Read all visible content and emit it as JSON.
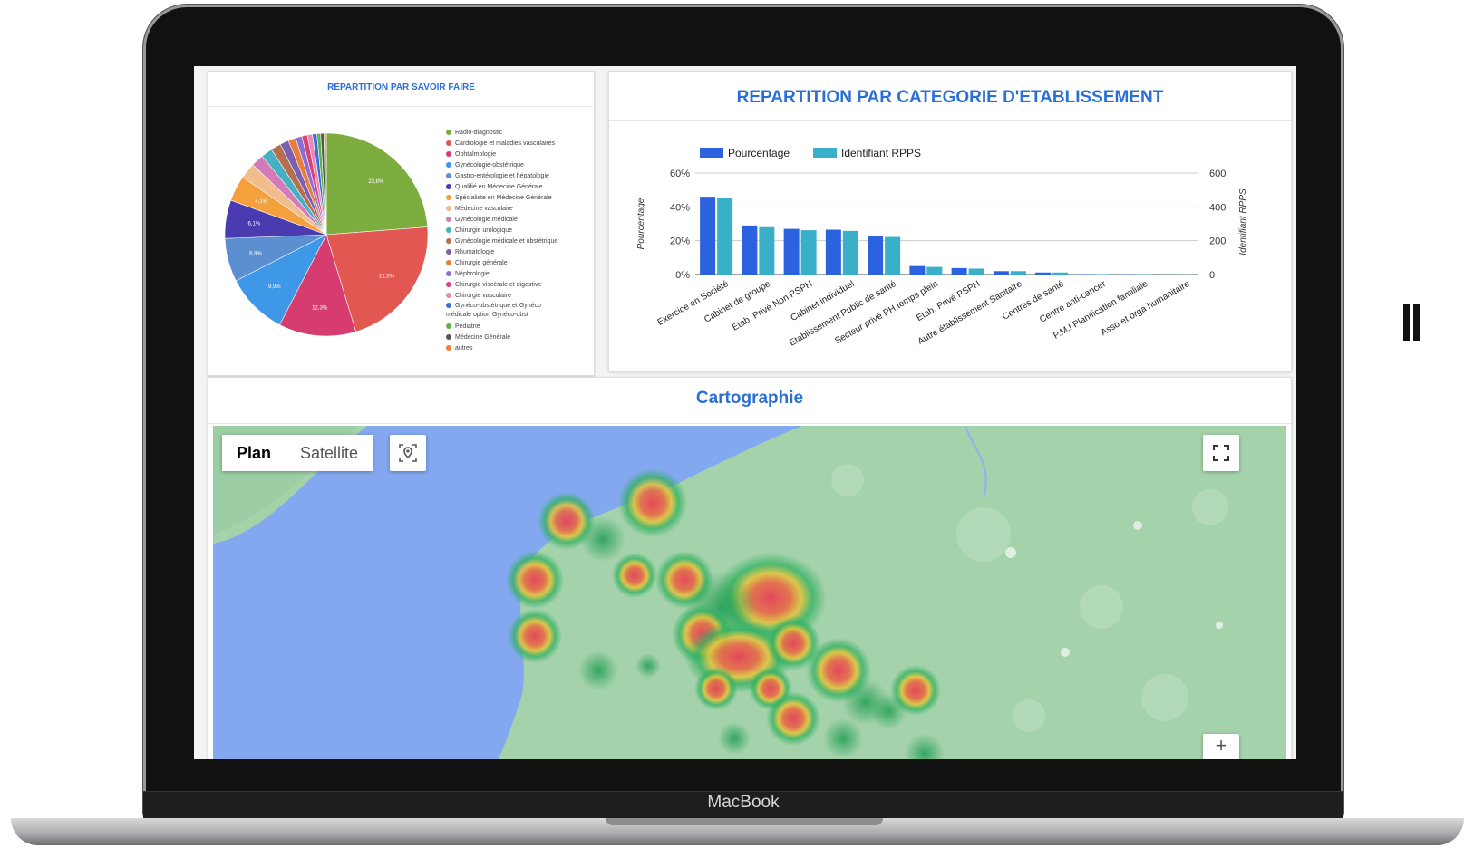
{
  "device": {
    "brand": "MacBook"
  },
  "savoir_faire": {
    "title": "REPARTITION PAR SAVOIR FAIRE",
    "legend": [
      {
        "label": "Radio-diagnostic",
        "color": "#7cad3e"
      },
      {
        "label": "Cardiologie et maladies vasculaires",
        "color": "#e35753"
      },
      {
        "label": "Ophtalmologie",
        "color": "#d63c6f"
      },
      {
        "label": "Gynécologie-obstétrique",
        "color": "#3f97e8"
      },
      {
        "label": "Gastro-entérologie et hépatologie",
        "color": "#5b8fd0"
      },
      {
        "label": "Qualifié en Médecine Générale",
        "color": "#4a3bb0"
      },
      {
        "label": "Spécialiste en Médecine Générale",
        "color": "#f4a03c"
      },
      {
        "label": "Médecine vasculaire",
        "color": "#f1bd8c"
      },
      {
        "label": "Gynécologie médicale",
        "color": "#d57ab9"
      },
      {
        "label": "Chirurgie urologique",
        "color": "#45b0c4"
      },
      {
        "label": "Gynécologie médicale et obstétrique",
        "color": "#b56f4f"
      },
      {
        "label": "Rhumatologie",
        "color": "#7b5fb0"
      },
      {
        "label": "Chirurgie générale",
        "color": "#e97d3a"
      },
      {
        "label": "Néphrologie",
        "color": "#8c6fd6"
      },
      {
        "label": "Chirurgie viscérale et digestive",
        "color": "#d8437c"
      },
      {
        "label": "Chirurgie vasculaire",
        "color": "#e88bb2"
      },
      {
        "label": "Gynéco-obstétrique et Gynéco médicale option Gynéco-obst",
        "color": "#3a6ed8"
      },
      {
        "label": "Pédiatrie",
        "color": "#61b14b"
      },
      {
        "label": "Médecine Générale",
        "color": "#555555"
      },
      {
        "label": "autres",
        "color": "#f07d3a"
      }
    ],
    "chart_data": {
      "type": "pie",
      "slices": [
        {
          "label": "Radio-diagnostic",
          "value": 23.8,
          "shown": "23,8%"
        },
        {
          "label": "Cardiologie et maladies vasculaires",
          "value": 21.5,
          "shown": "21,5%"
        },
        {
          "label": "Ophtalmologie",
          "value": 12.3,
          "shown": "12,3%"
        },
        {
          "label": "Gynécologie-obstétrique",
          "value": 9.9,
          "shown": "9,9%"
        },
        {
          "label": "Gastro-entérologie et hépatologie",
          "value": 6.9,
          "shown": "6,9%"
        },
        {
          "label": "Qualifié en Médecine Générale",
          "value": 6.1,
          "shown": "6,1%"
        },
        {
          "label": "Spécialiste en Médecine Générale",
          "value": 4.1,
          "shown": "4,1%"
        },
        {
          "label": "Médecine vasculaire",
          "value": 2.5,
          "shown": ""
        },
        {
          "label": "Gynécologie médicale",
          "value": 2.0,
          "shown": ""
        },
        {
          "label": "Chirurgie urologique",
          "value": 1.8,
          "shown": ""
        },
        {
          "label": "Gynécologie médicale et obstétrique",
          "value": 1.6,
          "shown": ""
        },
        {
          "label": "Rhumatologie",
          "value": 1.4,
          "shown": ""
        },
        {
          "label": "Chirurgie générale",
          "value": 1.2,
          "shown": ""
        },
        {
          "label": "Néphrologie",
          "value": 1.0,
          "shown": ""
        },
        {
          "label": "Chirurgie viscérale et digestive",
          "value": 0.9,
          "shown": ""
        },
        {
          "label": "Chirurgie vasculaire",
          "value": 0.8,
          "shown": ""
        },
        {
          "label": "Gynéco-obstétrique et Gynéco médicale option Gynéco-obst",
          "value": 0.7,
          "shown": ""
        },
        {
          "label": "Pédiatrie",
          "value": 0.6,
          "shown": ""
        },
        {
          "label": "Médecine Générale",
          "value": 0.5,
          "shown": ""
        },
        {
          "label": "autres",
          "value": 0.4,
          "shown": ""
        }
      ]
    }
  },
  "categorie": {
    "title": "REPARTITION PAR CATEGORIE D'ETABLISSEMENT",
    "chart_data": {
      "type": "bar",
      "title": "REPARTITION PAR CATEGORIE D'ETABLISSEMENT",
      "categories": [
        "Exercice en Société",
        "Cabinet de groupe",
        "Etab. Privé Non PSPH",
        "Cabinet individuel",
        "Etablissement Public de santé",
        "Secteur privé PH temps plein",
        "Etab. Privé PSPH",
        "Autre établissement Sanitaire",
        "Centres de santé",
        "Centre anti-cancer",
        "P.M.I Planification familiale",
        "Asso et orga humanitaire"
      ],
      "series": [
        {
          "name": "Pourcentage",
          "axis": "left",
          "color": "#2a62e0",
          "values": [
            46,
            29,
            27,
            26.5,
            23,
            5,
            3.8,
            2,
            1.2,
            0.3,
            0.2,
            0.1
          ]
        },
        {
          "name": "Identifiant RPPS",
          "axis": "right",
          "color": "#3ab0c8",
          "values": [
            450,
            280,
            262,
            258,
            222,
            45,
            35,
            20,
            12,
            3,
            2,
            1
          ]
        }
      ],
      "ylabel": "Pourcentage",
      "y2label": "Identifiant RPPS",
      "ylim": [
        0,
        60
      ],
      "y2lim": [
        0,
        600
      ],
      "yticks": [
        "0%",
        "20%",
        "40%",
        "60%"
      ],
      "y2ticks": [
        "0",
        "200",
        "400",
        "600"
      ],
      "legend_position": "top-left",
      "grid": true
    }
  },
  "carto": {
    "title": "Cartographie",
    "map_type_buttons": [
      "Plan",
      "Satellite"
    ],
    "active_map_type": "Plan",
    "controls": {
      "location_icon": "location-pin-icon",
      "fullscreen_icon": "fullscreen-icon"
    }
  }
}
